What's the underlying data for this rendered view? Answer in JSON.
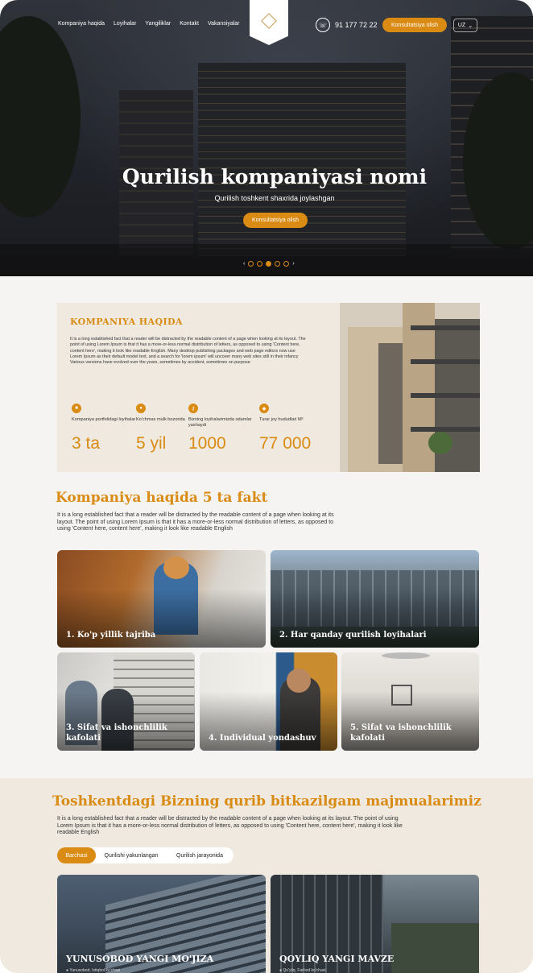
{
  "header": {
    "nav": [
      "Kompaniya haqida",
      "Loyihalar",
      "Yangiliklar",
      "Kontakt",
      "Vakansiyalar"
    ],
    "phone": "91 177 72 22",
    "cta": "Konsultatsiya olish",
    "lang": "UZ"
  },
  "hero": {
    "title": "Qurilish kompaniyasi nomi",
    "subtitle": "Qurilish toshkent shaxrida joylashgan",
    "cta": "Konsultatsiya olish",
    "slides": 5,
    "active_slide": 3
  },
  "about": {
    "title": "KOMPANIYA HAQIDA",
    "text": "It is a long established fact that a reader will be distracted by the readable content of a page when looking at its layout. The point of using Lorem Ipsum is that it has a more-or-less normal distribution of letters, as opposed to using 'Content here, content here', making it look like readable English. Many desktop publishing packages and web page editors now use Lorem Ipsum as their default model text, and a search for 'lorem ipsum' will uncover many web sites still in their infancy Various versions have evolved over the years, sometimes by accident, sometimes on purpose",
    "stats": [
      {
        "label": "Kompaniya portfelidagi loyihalar",
        "value": "3 ta"
      },
      {
        "label": "Ko'chmas mulk bozorida",
        "value": "5 yil"
      },
      {
        "label": "Bizning loyihalarimizda odamlar yashaydi",
        "value": "1000"
      },
      {
        "label": "Turar joy hududlari M²",
        "value": "77 000"
      }
    ]
  },
  "facts": {
    "title": "Kompaniya haqida 5 ta fakt",
    "text": "It is a long established fact that a reader will be distracted by the readable content of a page when looking at its layout. The point of using Lorem Ipsum is that it has a more-or-less normal distribution of letters, as opposed to using 'Content here, content here', making it look like readable English",
    "cards": [
      "1. Ko'p yillik tajriba",
      "2. Har qanday qurilish loyihalari",
      "3. Sifat va ishonchlilik kafolati",
      "4. Individual yondashuv",
      "5. Sifat va ishonchlilik kafolati"
    ]
  },
  "complexes": {
    "title": "Toshkentdagi Bizning qurib bitkazilgam majmualarimiz",
    "text": "It is a long established fact that a reader will be distracted by the readable content of a page when looking at its layout. The point of using Lorem Ipsum is that it has a more-or-less normal distribution of letters, as opposed to using 'Content here, content here', making it look like readable English",
    "tabs": [
      "Barchasi",
      "Qurilishi yakunlangan",
      "Qurilish jarayonida"
    ],
    "items": [
      {
        "name": "YUNUSOBOD YANGI MO'JIZA",
        "address": "Yunusobod, Istiqbol ko'chasi"
      },
      {
        "name": "QOYLIQ YANGI MAVZE",
        "address": "Qo'yliq, Farhod ko'chasi"
      }
    ]
  },
  "colors": {
    "accent": "#d98b13",
    "beige": "#efe9df"
  }
}
